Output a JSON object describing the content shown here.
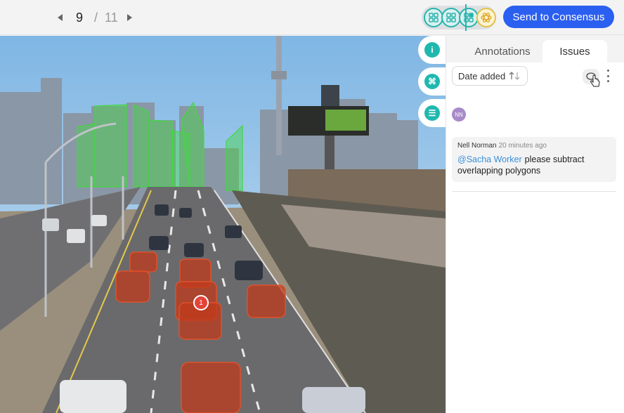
{
  "pager": {
    "current": "9",
    "separator": "/",
    "total": "11"
  },
  "stages": [
    "annotate-stage-icon",
    "review-stage-icon",
    "review-stage-icon",
    "consensus-stage-icon"
  ],
  "header": {
    "send_button": "Send to Consensus"
  },
  "rail": [
    {
      "icon": "info-icon",
      "glyph": "i"
    },
    {
      "icon": "command-icon",
      "glyph": "⌘"
    },
    {
      "icon": "list-icon",
      "glyph": "☰"
    }
  ],
  "panel": {
    "tabs": {
      "annotations": "Annotations",
      "issues": "Issues"
    },
    "sort_label": "Date added",
    "avatar_initials": "NN",
    "comment": {
      "author": "Nell Norman",
      "time": "20 minutes ago",
      "mention": "@Sacha Worker",
      "text": "please subtract overlapping polygons"
    }
  },
  "image": {
    "issue_pin": "1"
  },
  "colors": {
    "accent": "#2b5ff0",
    "teal": "#20b8ae",
    "mention": "#3a8fd6",
    "car_polygon": "#c0391b",
    "building_polygon": "#42d842"
  }
}
